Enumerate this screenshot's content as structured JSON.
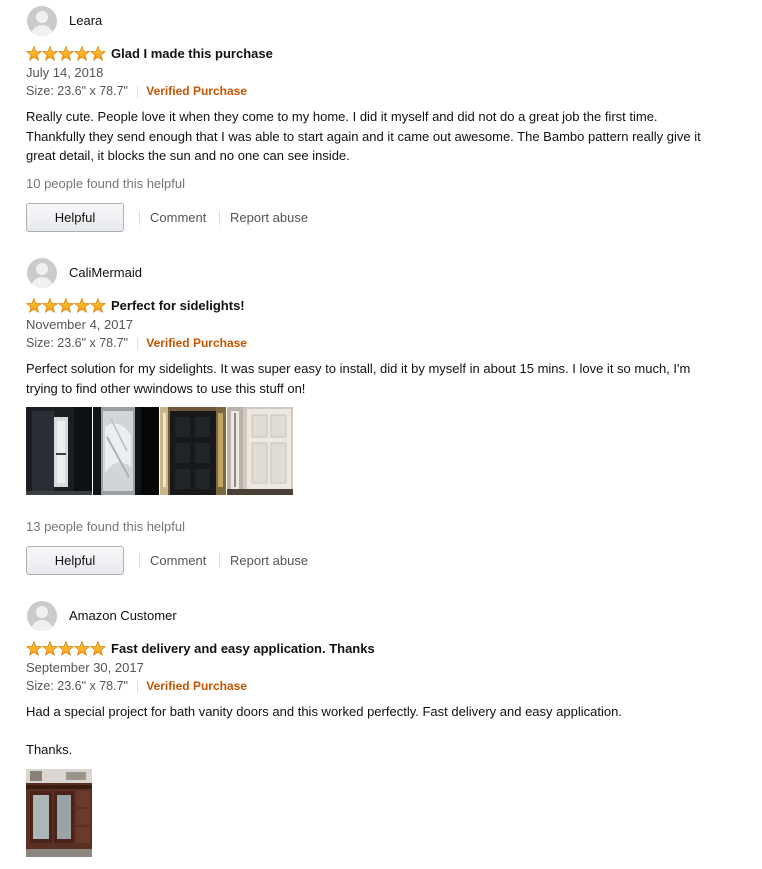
{
  "reviews": [
    {
      "author": "Leara",
      "rating": 5,
      "title": "Glad I made this purchase",
      "date": "July 14, 2018",
      "size": "Size: 23.6\" x 78.7\"",
      "verified": "Verified Purchase",
      "body": [
        "Really cute. People love it when they come to my home. I did it myself and did not do a great job the first time. Thankfully they send enough that I was able to start again and it came out awesome. The Bambo pattern really give it great detail, it blocks the sun and no one can see inside."
      ],
      "helpful_count": "10 people found this helpful"
    },
    {
      "author": "CaliMermaid",
      "rating": 5,
      "title": "Perfect for sidelights!",
      "date": "November 4, 2017",
      "size": "Size: 23.6\" x 78.7\"",
      "verified": "Verified Purchase",
      "body": [
        "Perfect solution for my sidelights. It was super easy to install, did it by myself in about 15 mins. I love it so much, I'm trying to find other wwindows to use this stuff on!"
      ],
      "helpful_count": "13 people found this helpful"
    },
    {
      "author": "Amazon Customer",
      "rating": 5,
      "title": "Fast delivery and easy application. Thanks",
      "date": "September 30, 2017",
      "size": "Size: 23.6\" x 78.7\"",
      "verified": "Verified Purchase",
      "body": [
        "Had a special project for bath vanity doors and this worked perfectly. Fast delivery and easy application.",
        "Thanks."
      ]
    }
  ],
  "actions": {
    "helpful": "Helpful",
    "comment": "Comment",
    "report": "Report abuse"
  },
  "colors": {
    "verified": "#c45500",
    "star": "#ffa41c"
  }
}
